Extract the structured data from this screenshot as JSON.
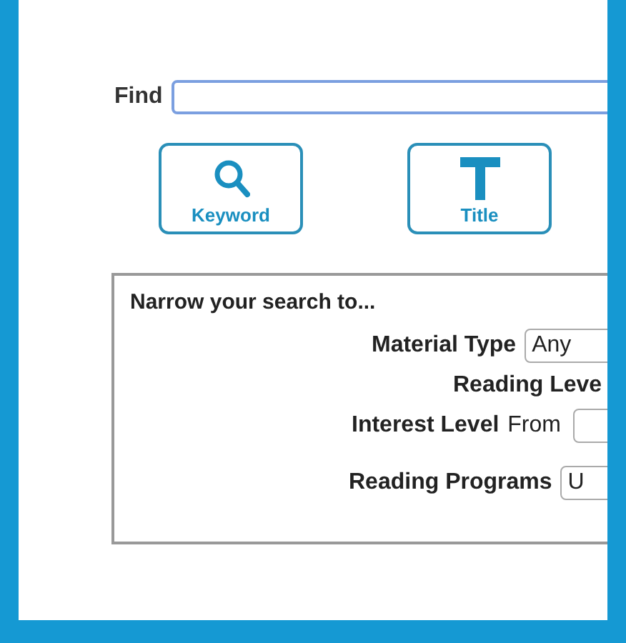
{
  "search": {
    "label": "Find"
  },
  "buttons": [
    {
      "kind": "keyword",
      "label": "Keyword"
    },
    {
      "kind": "title",
      "label": "Title"
    }
  ],
  "narrow": {
    "title": "Narrow your search to...",
    "fields": [
      {
        "kind": "select",
        "label": "Material Type",
        "value": "Any"
      },
      {
        "kind": "label",
        "label": "Reading Leve"
      },
      {
        "kind": "range",
        "label": "Interest Level",
        "from": "From"
      },
      {
        "kind": "select",
        "label": "Reading Programs",
        "value": "U"
      }
    ]
  }
}
